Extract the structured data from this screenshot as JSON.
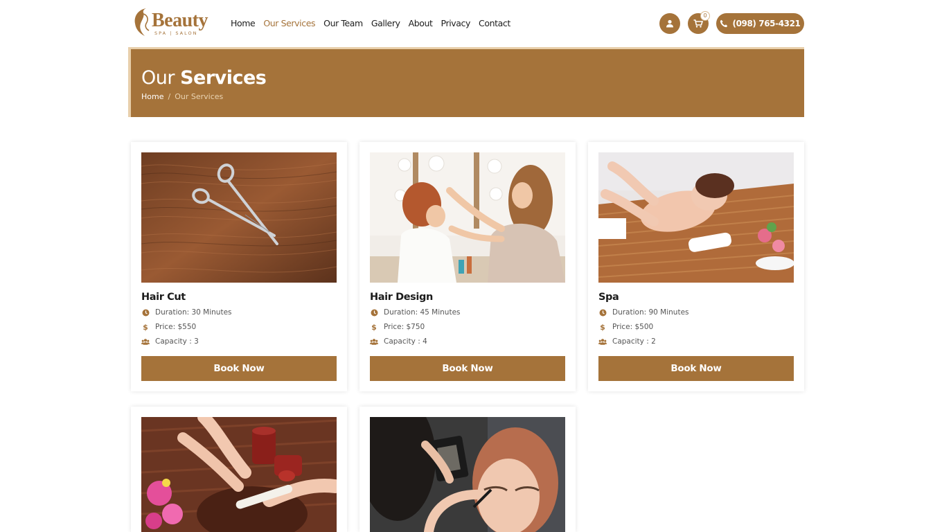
{
  "brand": {
    "name": "Beauty",
    "tagline": "SPA | SALON"
  },
  "nav": {
    "items": [
      {
        "label": "Home"
      },
      {
        "label": "Our Services",
        "active": true
      },
      {
        "label": "Our Team"
      },
      {
        "label": "Gallery"
      },
      {
        "label": "About"
      },
      {
        "label": "Privacy"
      },
      {
        "label": "Contact"
      }
    ]
  },
  "header": {
    "cart_count": "0",
    "phone": "(098) 765-4321"
  },
  "banner": {
    "title_light": "Our",
    "title_bold": "Services"
  },
  "breadcrumb": {
    "home": "Home",
    "separator": "/",
    "current": "Our Services"
  },
  "services": [
    {
      "name": "Hair Cut",
      "duration": "Duration: 30 Minutes",
      "price": "Price: $550",
      "capacity": "Capacity : 3",
      "button": "Book Now"
    },
    {
      "name": "Hair Design",
      "duration": "Duration: 45 Minutes",
      "price": "Price: $750",
      "capacity": "Capacity : 4",
      "button": "Book Now"
    },
    {
      "name": "Spa",
      "duration": "Duration: 90 Minutes",
      "price": "Price: $500",
      "capacity": "Capacity : 2",
      "button": "Book Now"
    },
    {
      "name": "",
      "duration": "",
      "price": "",
      "capacity": "",
      "button": ""
    },
    {
      "name": "",
      "duration": "",
      "price": "",
      "capacity": "",
      "button": ""
    }
  ],
  "colors": {
    "accent": "#a5733a",
    "accent_light": "#e8cfab"
  },
  "icons": {
    "user": "user-icon",
    "cart": "cart-icon",
    "phone": "phone-icon",
    "clock": "clock-icon",
    "dollar": "dollar-icon",
    "users": "users-icon"
  }
}
